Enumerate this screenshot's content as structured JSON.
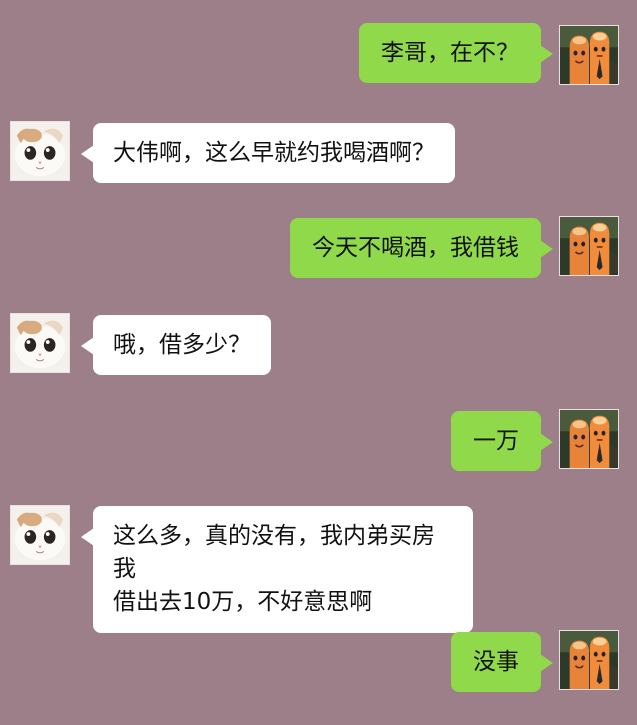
{
  "colors": {
    "background": "#9c7f88",
    "outgoing_bubble": "#8fd94a",
    "incoming_bubble": "#ffffff"
  },
  "contacts": {
    "self_avatar": "finger-puppets-avatar",
    "friend_avatar": "white-cat-avatar"
  },
  "messages": [
    {
      "side": "right",
      "text": "李哥，在不？"
    },
    {
      "side": "left",
      "text": "大伟啊，这么早就约我喝酒啊？"
    },
    {
      "side": "right",
      "text": "今天不喝酒，我借钱"
    },
    {
      "side": "left",
      "text": "哦，借多少？"
    },
    {
      "side": "right",
      "text": "一万"
    },
    {
      "side": "left",
      "lines": [
        "这么多，真的没有，我内弟买房我",
        "借出去10万，不好意思啊"
      ]
    },
    {
      "side": "right",
      "text": "没事"
    }
  ]
}
